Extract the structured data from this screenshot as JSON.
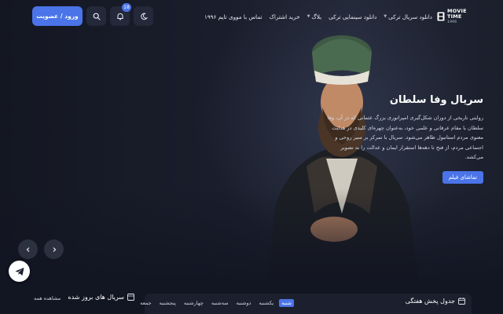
{
  "header": {
    "login_label": "ورود / عضویت",
    "notification_count": "18",
    "nav": [
      {
        "label": "دانلود سریال ترکی",
        "has_dropdown": true
      },
      {
        "label": "دانلود سینمایی ترکی",
        "has_dropdown": false
      },
      {
        "label": "بلاگ",
        "has_dropdown": true
      },
      {
        "label": "خرید اشتراک",
        "has_dropdown": false
      },
      {
        "label": "تماس با مووی تایم ۱۹۹۶",
        "has_dropdown": false
      }
    ],
    "logo_line1": "MOVIE",
    "logo_line2": "TIME",
    "logo_sub": "1996"
  },
  "hero": {
    "title": "سریال وفا سلطان",
    "description": "روایتی تاریخی از دوران شکل‌گیری امپراتوری بزرگ عثمانی که در آن، وفا سلطان با مقام عرفانی و علمی خود، به‌عنوان چهره‌ای کلیدی در هدایت معنوی مردم استانبول ظاهر می‌شود. سریال با تمرکز بر سیر روحی و اجتماعی مردم، از فتح تا دهه‌ها استقرار ایمان و عدالت را به تصویر می‌کشد.",
    "watch_label": "تماشای فیلم"
  },
  "sections": {
    "updated_series_title": "سریال های بروز شده",
    "view_all_label": "مشاهده همه",
    "schedule_title": "جدول پخش هفتگی",
    "days": [
      "شنبه",
      "یکشنبه",
      "دوشنبه",
      "سه‌شنبه",
      "چهارشنبه",
      "پنجشنبه",
      "جمعه"
    ],
    "active_day": "شنبه"
  },
  "colors": {
    "accent": "#4a74e8",
    "background": "#121522",
    "button_dark": "#23283a"
  },
  "icons": [
    "moon-icon",
    "bell-icon",
    "search-icon",
    "chevron-left-icon",
    "chevron-right-icon",
    "telegram-icon",
    "calendar-icon",
    "film-icon"
  ]
}
